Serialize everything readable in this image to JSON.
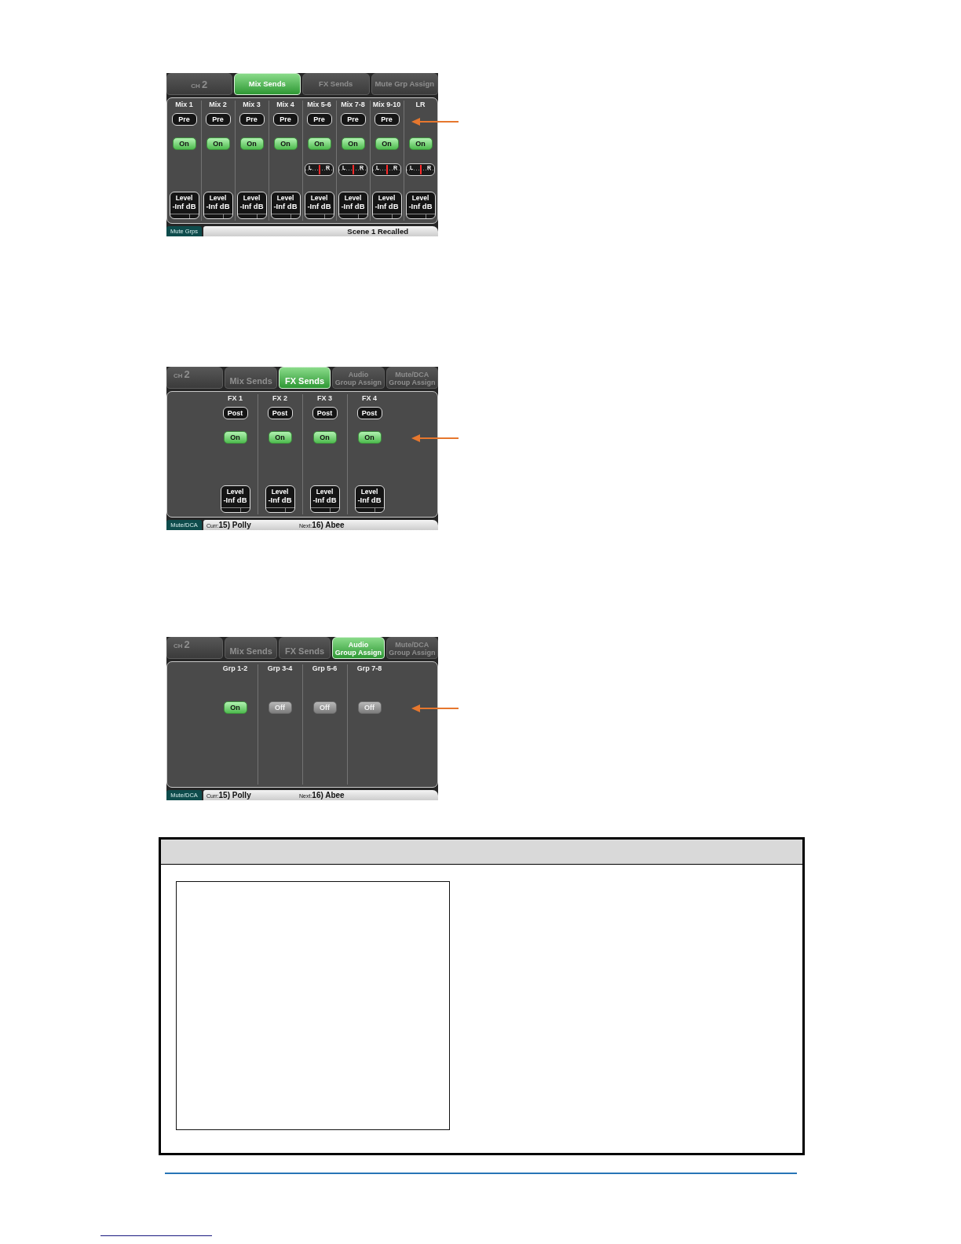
{
  "screens": [
    {
      "arrow": {
        "kind": "mode"
      },
      "tabs": [
        {
          "kind": "channel",
          "prefix": "CH",
          "number": "2",
          "selected": false
        },
        {
          "kind": "page",
          "lines": [
            "Mix Sends"
          ],
          "selected": true
        },
        {
          "kind": "page",
          "lines": [
            "FX Sends"
          ],
          "selected": false
        },
        {
          "kind": "page",
          "lines": [
            "Mute Grp Assign"
          ],
          "selected": false
        }
      ],
      "columns": [
        {
          "label": "Mix 1",
          "mode": "Pre",
          "switch": {
            "label": "On",
            "on": true
          },
          "fader": {
            "label": "Level",
            "value": "-Inf dB"
          }
        },
        {
          "label": "Mix 2",
          "mode": "Pre",
          "switch": {
            "label": "On",
            "on": true
          },
          "fader": {
            "label": "Level",
            "value": "-Inf dB"
          }
        },
        {
          "label": "Mix 3",
          "mode": "Pre",
          "switch": {
            "label": "On",
            "on": true
          },
          "fader": {
            "label": "Level",
            "value": "-Inf dB"
          }
        },
        {
          "label": "Mix 4",
          "mode": "Pre",
          "switch": {
            "label": "On",
            "on": true
          },
          "fader": {
            "label": "Level",
            "value": "-Inf dB"
          }
        },
        {
          "label": "Mix 5-6",
          "mode": "Pre",
          "switch": {
            "label": "On",
            "on": true
          },
          "pan": {
            "left": "L",
            "right": "R",
            "level": 0.5
          },
          "fader": {
            "label": "Level",
            "value": "-Inf dB"
          }
        },
        {
          "label": "Mix 7-8",
          "mode": "Pre",
          "switch": {
            "label": "On",
            "on": true
          },
          "pan": {
            "left": "L",
            "right": "R",
            "level": 0.5
          },
          "fader": {
            "label": "Level",
            "value": "-Inf dB"
          }
        },
        {
          "label": "Mix 9-10",
          "mode": "Pre",
          "switch": {
            "label": "On",
            "on": true
          },
          "pan": {
            "left": "L",
            "right": "R",
            "level": 0.5
          },
          "fader": {
            "label": "Level",
            "value": "-Inf dB"
          }
        },
        {
          "label": "LR",
          "switch": {
            "label": "On",
            "on": true
          },
          "pan": {
            "left": "L",
            "right": "R",
            "level": 0.5
          },
          "fader": {
            "label": "Level",
            "value": "-Inf dB"
          }
        }
      ],
      "status_bar": {
        "tag": "Mute Grps",
        "message": "Scene 1 Recalled"
      }
    },
    {
      "arrow": {
        "kind": "switch"
      },
      "tabs": [
        {
          "kind": "channel",
          "prefix": "CH",
          "number": "2",
          "selected": false
        },
        {
          "kind": "page",
          "lines": [
            "Mix Sends"
          ],
          "selected": false
        },
        {
          "kind": "page",
          "lines": [
            "FX Sends"
          ],
          "selected": true
        },
        {
          "kind": "page",
          "lines": [
            "Audio",
            "Group Assign"
          ],
          "selected": false
        },
        {
          "kind": "page",
          "lines": [
            "Mute/DCA",
            "Group Assign"
          ],
          "selected": false
        }
      ],
      "columns": [
        {
          "label": "FX 1",
          "mode": "Post",
          "switch": {
            "label": "On",
            "on": true
          },
          "fader": {
            "label": "Level",
            "value": "-Inf dB"
          }
        },
        {
          "label": "FX 2",
          "mode": "Post",
          "switch": {
            "label": "On",
            "on": true
          },
          "fader": {
            "label": "Level",
            "value": "-Inf dB"
          }
        },
        {
          "label": "FX 3",
          "mode": "Post",
          "switch": {
            "label": "On",
            "on": true
          },
          "fader": {
            "label": "Level",
            "value": "-Inf dB"
          }
        },
        {
          "label": "FX 4",
          "mode": "Post",
          "switch": {
            "label": "On",
            "on": true
          },
          "fader": {
            "label": "Level",
            "value": "-Inf dB"
          }
        }
      ],
      "status_bar": {
        "tag": "Mute/DCA",
        "fields": [
          {
            "label": "Curr:",
            "value": "15) Polly"
          },
          {
            "label": "Next:",
            "value": "16) Abee"
          }
        ]
      }
    },
    {
      "arrow": {
        "kind": "switch"
      },
      "tabs": [
        {
          "kind": "channel",
          "prefix": "CH",
          "number": "2",
          "selected": false
        },
        {
          "kind": "page",
          "lines": [
            "Mix Sends"
          ],
          "selected": false
        },
        {
          "kind": "page",
          "lines": [
            "FX Sends"
          ],
          "selected": false
        },
        {
          "kind": "page",
          "lines": [
            "Audio",
            "Group Assign"
          ],
          "selected": true
        },
        {
          "kind": "page",
          "lines": [
            "Mute/DCA",
            "Group Assign"
          ],
          "selected": false
        }
      ],
      "columns": [
        {
          "label": "Grp 1-2",
          "switch": {
            "label": "On",
            "on": true
          }
        },
        {
          "label": "Grp 3-4",
          "switch": {
            "label": "Off",
            "on": false
          }
        },
        {
          "label": "Grp 5-6",
          "switch": {
            "label": "Off",
            "on": false
          }
        },
        {
          "label": "Grp 7-8",
          "switch": {
            "label": "Off",
            "on": false
          }
        }
      ],
      "status_bar": {
        "tag": "Mute/DCA",
        "fields": [
          {
            "label": "Curr:",
            "value": "15) Polly"
          },
          {
            "label": "Next:",
            "value": "16) Abee"
          }
        ]
      }
    }
  ]
}
